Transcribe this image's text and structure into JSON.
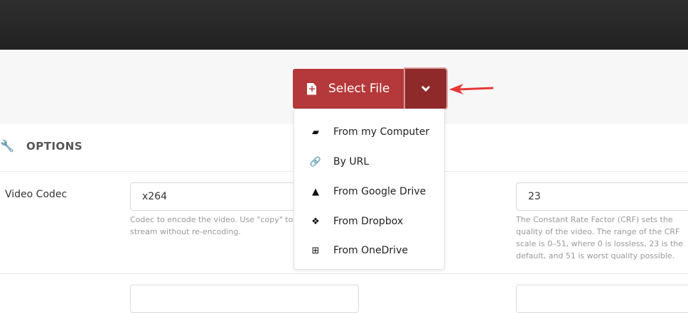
{
  "header": {
    "select_file": "Select File"
  },
  "dropdown": {
    "items": [
      {
        "label": "From my Computer",
        "icon": "folder-open-icon"
      },
      {
        "label": "By URL",
        "icon": "link-icon"
      },
      {
        "label": "From Google Drive",
        "icon": "google-drive-icon"
      },
      {
        "label": "From Dropbox",
        "icon": "dropbox-icon"
      },
      {
        "label": "From OneDrive",
        "icon": "windows-icon"
      }
    ]
  },
  "options": {
    "title": "OPTIONS",
    "video_codec": {
      "label": "Video Codec",
      "value": "x264",
      "help": "Codec to encode the video. Use \"copy\" to copy the stream without re-encoding."
    },
    "crf": {
      "value": "23",
      "help": "The Constant Rate Factor (CRF) sets the quality of the video. The range of the CRF scale is 0–51, where 0 is lossless, 23 is the default, and 51 is worst quality possible."
    }
  },
  "colors": {
    "primary": "#b5393a",
    "primary_dark": "#8e2a2a",
    "annotation_arrow": "#e53935"
  }
}
